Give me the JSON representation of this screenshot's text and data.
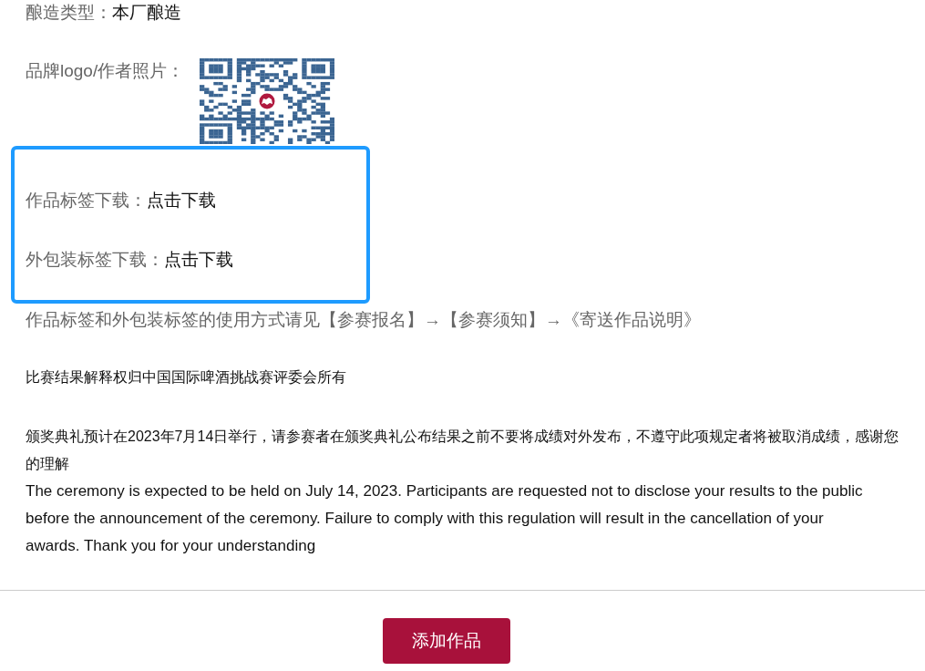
{
  "fields": [
    {
      "kind": "text",
      "label": "酿造类型：",
      "value": "本厂酿造"
    },
    {
      "kind": "image",
      "label": "品牌logo/作者照片："
    }
  ],
  "downloads": {
    "highlighted": true,
    "items": [
      {
        "label": "作品标签下载：",
        "link": "点击下载"
      },
      {
        "label": "外包装标签下载：",
        "link": "点击下载"
      }
    ]
  },
  "usage_note": "作品标签和外包装标签的使用方式请见【参赛报名】→【参赛须知】→《寄送作品说明》",
  "rights_note": "比赛结果解释权归中国国际啤酒挑战赛评委会所有",
  "ceremony_note_zh": "颁奖典礼预计在2023年7月14日举行，请参赛者在颁奖典礼公布结果之前不要将成绩对外发布，不遵守此项规定者将被取消成绩，感谢您的理解",
  "ceremony_note_en": "The ceremony is expected to be held on July 14, 2023. Participants are requested not to disclose your results to the public before the announcement of the ceremony. Failure to comply with this regulation will result in the cancellation of your awards. Thank you for your understanding",
  "add_button": "添加作品"
}
